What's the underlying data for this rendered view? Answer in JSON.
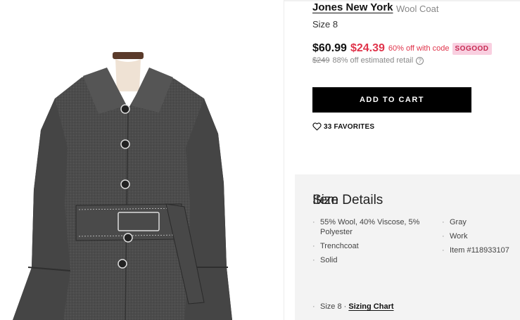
{
  "product": {
    "brand": "Jones New York",
    "type": "Wool Coat",
    "size": "Size 8",
    "price_original": "$60.99",
    "price_sale": "$24.39",
    "discount_text": "60% off with code",
    "promo_code": "SOGOOD",
    "retail_price": "$249",
    "retail_text": "88% off estimated retail",
    "add_to_cart_label": "ADD TO CART",
    "favorites_label": "33 FAVORITES"
  },
  "details": {
    "heading": "Item Details",
    "left_items": [
      "55% Wool, 40% Viscose, 5% Polyester",
      "Trenchcoat",
      "Solid"
    ],
    "right_items": [
      "Gray",
      "Work",
      "Item #118933107"
    ],
    "size_heading": "Size",
    "size_prefix": "Size 8 · ",
    "sizing_chart_link": "Sizing Chart"
  },
  "colors": {
    "sale_red": "#e0344b",
    "promo_bg": "#f9cfe0",
    "details_bg": "#f3f3f3",
    "coat_gray": "#4a4a4a"
  },
  "icons": [
    "heart-icon",
    "info-icon"
  ]
}
